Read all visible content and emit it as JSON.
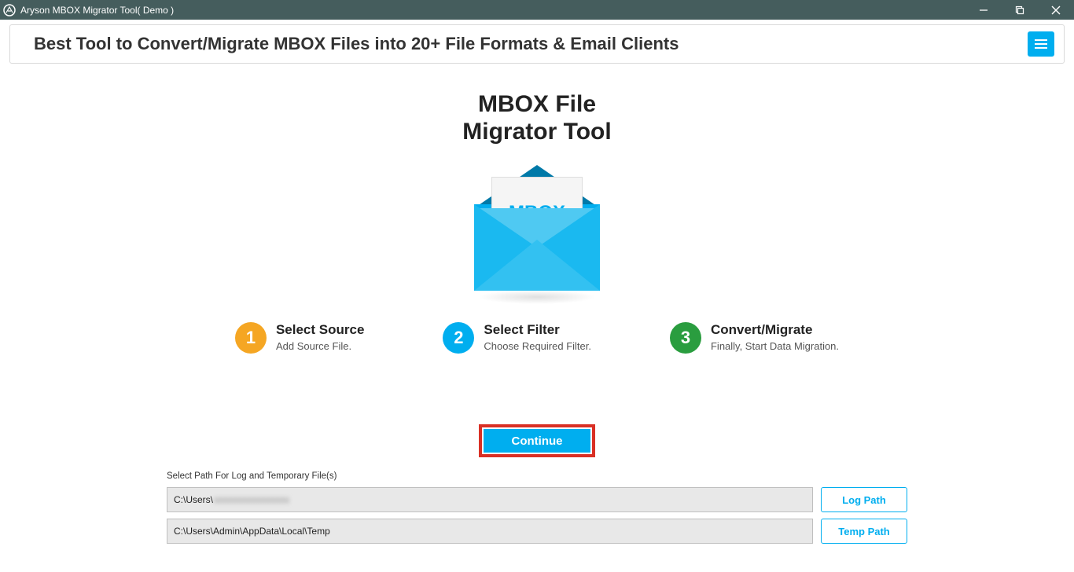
{
  "window": {
    "title": "Aryson MBOX Migrator Tool( Demo )"
  },
  "banner": {
    "headline": "Best Tool to Convert/Migrate MBOX Files into 20+ File Formats & Email Clients"
  },
  "hero": {
    "title_line1": "MBOX File",
    "title_line2": "Migrator Tool",
    "envelope_label": "MBOX"
  },
  "steps": [
    {
      "num": "1",
      "title": "Select Source",
      "desc": "Add Source File."
    },
    {
      "num": "2",
      "title": "Select Filter",
      "desc": "Choose Required Filter."
    },
    {
      "num": "3",
      "title": "Convert/Migrate",
      "desc": "Finally, Start Data Migration."
    }
  ],
  "actions": {
    "continue": "Continue"
  },
  "paths": {
    "group_label": "Select Path For Log and Temporary File(s)",
    "log": {
      "value": "C:\\Users\\",
      "masked": "xxxxxxxxxxxxxxxx",
      "button": "Log Path"
    },
    "temp": {
      "value": "C:\\Users\\Admin\\AppData\\Local\\Temp",
      "button": "Temp Path"
    }
  }
}
